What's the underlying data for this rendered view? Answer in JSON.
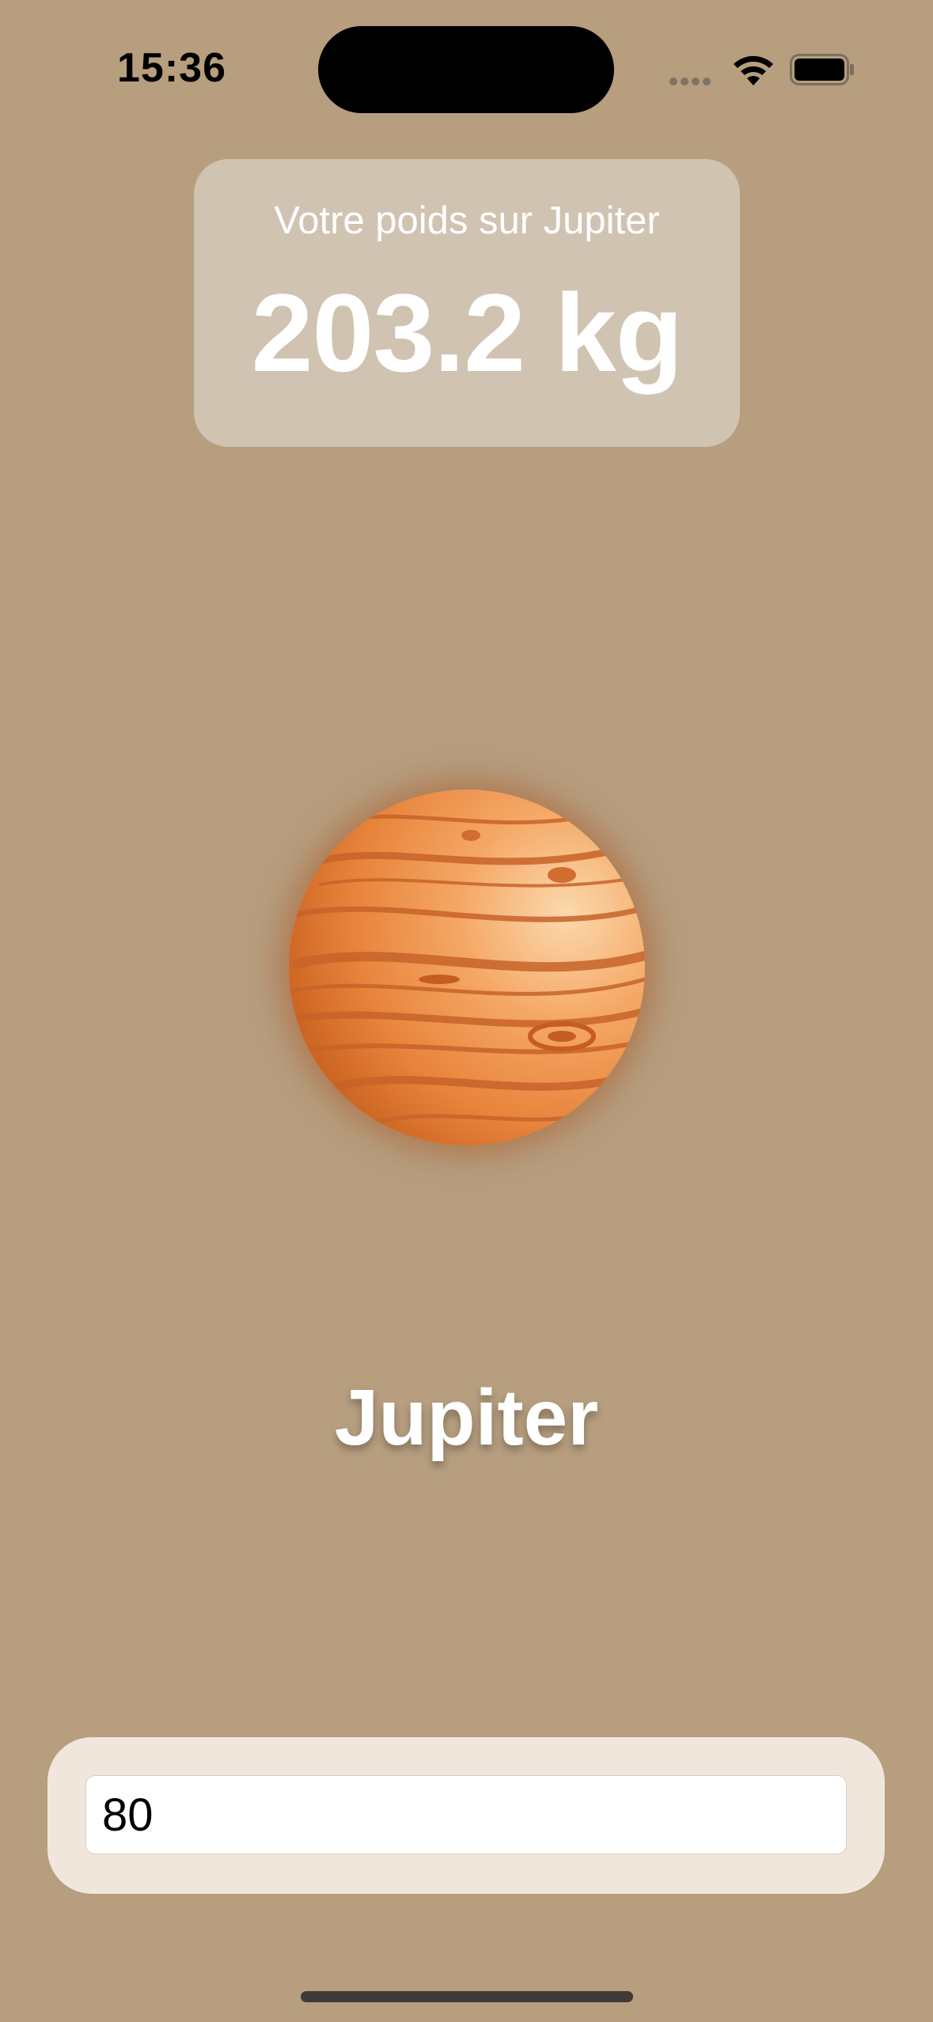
{
  "status_bar": {
    "time": "15:36",
    "icons": [
      "signal-dots-icon",
      "wifi-icon",
      "battery-icon"
    ]
  },
  "weight_card": {
    "label": "Votre poids sur Jupiter",
    "value": "203.2 kg"
  },
  "planet": {
    "name": "Jupiter",
    "image": "jupiter-planet-illustration"
  },
  "input": {
    "value": "80"
  },
  "colors": {
    "background": "#b69e7f",
    "card": "#cbbdaf",
    "input_panel": "#f0e6dc",
    "planet_orange": "#e8833a"
  }
}
